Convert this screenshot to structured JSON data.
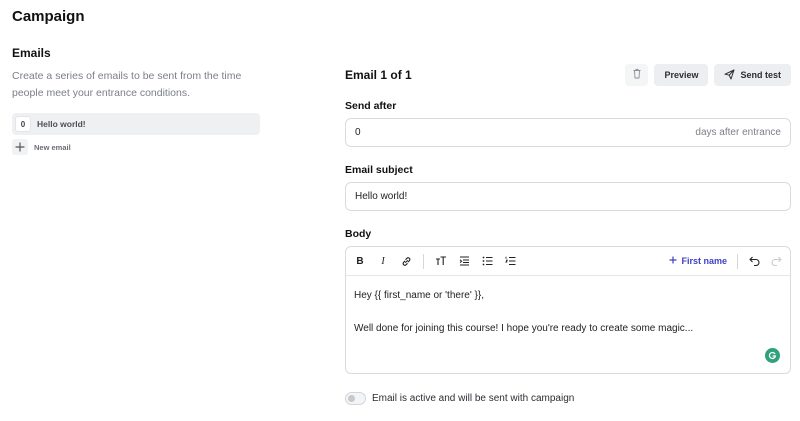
{
  "page": {
    "title": "Campaign"
  },
  "emails_section": {
    "title": "Emails",
    "description": "Create a series of emails to be sent from the time people meet your entrance conditions.",
    "items": [
      {
        "index": "0",
        "label": "Hello world!"
      }
    ],
    "new_email_label": "New email"
  },
  "editor": {
    "header": "Email 1 of 1",
    "actions": {
      "delete_icon": "trash-icon",
      "preview_label": "Preview",
      "send_test_label": "Send test",
      "send_test_icon": "paper-plane-icon"
    },
    "send_after": {
      "label": "Send after",
      "value": "0",
      "suffix": "days after entrance"
    },
    "subject": {
      "label": "Email subject",
      "value": "Hello world!"
    },
    "body": {
      "label": "Body",
      "toolbar": {
        "bold": "B",
        "italic": "I",
        "link_icon": "link-icon",
        "text_size_icon": "text-size-icon",
        "indent_icon": "indent-icon",
        "bullet_list_icon": "bullet-list-icon",
        "numbered_list_icon": "numbered-list-icon",
        "insert_field_label": "First name",
        "undo_icon": "undo-icon",
        "redo_icon": "redo-icon"
      },
      "lines": [
        "Hey {{ first_name or 'there' }},",
        "Well done for joining this course! I hope you're ready to create some magic..."
      ]
    },
    "active_toggle": {
      "label": "Email is active and will be sent with campaign",
      "on": false
    }
  },
  "colors": {
    "accent": "#3f3fc4",
    "grammarly": "#2fa27a",
    "border": "#d8dbdf"
  }
}
